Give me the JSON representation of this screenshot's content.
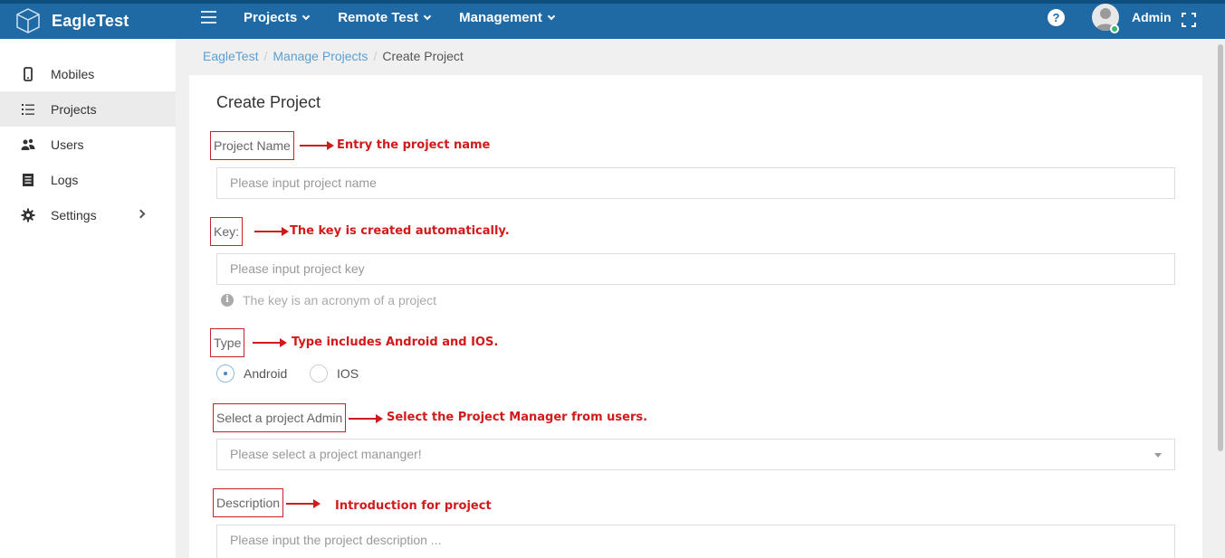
{
  "header": {
    "brand": "EagleTest",
    "nav": [
      "Projects",
      "Remote Test",
      "Management"
    ],
    "help_icon": "question-circle-icon",
    "user": "Admin",
    "colors": {
      "bar": "#1f6aa5",
      "accent": "#5a9fd4",
      "annotation": "#d11a1a"
    }
  },
  "sidebar": {
    "items": [
      {
        "label": "Mobiles",
        "icon": "mobile-icon"
      },
      {
        "label": "Projects",
        "icon": "list-icon"
      },
      {
        "label": "Users",
        "icon": "users-icon"
      },
      {
        "label": "Logs",
        "icon": "document-icon"
      },
      {
        "label": "Settings",
        "icon": "gear-icon"
      }
    ]
  },
  "breadcrumb": {
    "root": "EagleTest",
    "parent": "Manage Projects",
    "current": "Create Project"
  },
  "form": {
    "title": "Create Project",
    "name_label": "Project Name",
    "name_placeholder": "Please input project name",
    "key_label": "Key:",
    "key_placeholder": "Please input project key",
    "key_hint": "The key is an acronym of a project",
    "type_label": "Type",
    "type_options": [
      "Android",
      "IOS"
    ],
    "type_selected": "Android",
    "admin_label": "Select a project Admin",
    "admin_placeholder": "Please select a project mananger!",
    "desc_label": "Description",
    "desc_placeholder": "Please input the project description ..."
  },
  "annotations": {
    "name": "Entry the project name",
    "key": "The key is created automatically.",
    "type": "Type includes Android and IOS.",
    "admin": "Select the Project Manager from users.",
    "desc": "Introduction for project"
  }
}
